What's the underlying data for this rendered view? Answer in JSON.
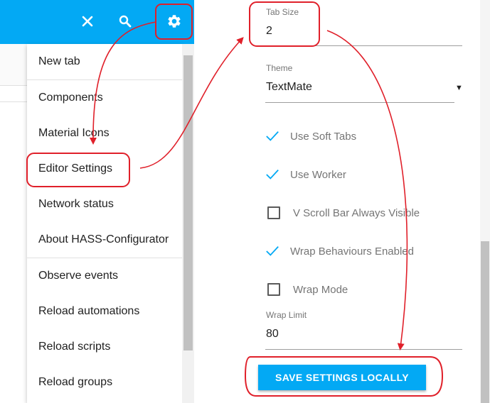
{
  "header": {
    "close_icon": "close-icon",
    "search_icon": "search-icon",
    "settings_icon": "gear-icon",
    "bar_color": "#03a9f4"
  },
  "menu": {
    "items": [
      {
        "label": "New tab"
      },
      {
        "label": "Components"
      },
      {
        "label": "Material Icons"
      },
      {
        "label": "Editor Settings"
      },
      {
        "label": "Network status"
      },
      {
        "label": "About HASS-Configurator"
      },
      {
        "label": "Observe events"
      },
      {
        "label": "Reload automations"
      },
      {
        "label": "Reload scripts"
      },
      {
        "label": "Reload groups"
      }
    ]
  },
  "settings": {
    "tab_size": {
      "label": "Tab Size",
      "value": "2"
    },
    "theme": {
      "label": "Theme",
      "value": "TextMate"
    },
    "checkboxes": [
      {
        "label": "Use Soft Tabs",
        "checked": true
      },
      {
        "label": "Use Worker",
        "checked": true
      },
      {
        "label": "V Scroll Bar Always Visible",
        "checked": false
      },
      {
        "label": "Wrap Behaviours Enabled",
        "checked": true
      },
      {
        "label": "Wrap Mode",
        "checked": false
      }
    ],
    "wrap_limit": {
      "label": "Wrap Limit",
      "value": "80"
    },
    "save_label": "Save Settings Locally"
  },
  "colors": {
    "accent": "#03a9f4",
    "annotation": "#e0202a",
    "check": "#03a9f4"
  }
}
